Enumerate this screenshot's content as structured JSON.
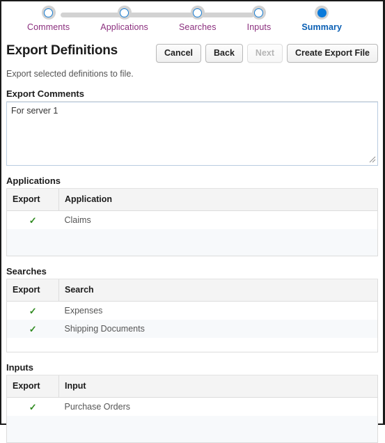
{
  "wizard": {
    "steps": [
      {
        "label": "Comments",
        "active": false
      },
      {
        "label": "Applications",
        "active": false
      },
      {
        "label": "Searches",
        "active": false
      },
      {
        "label": "Inputs",
        "active": false
      },
      {
        "label": "Summary",
        "active": true
      }
    ],
    "active_color": "#0a7ada",
    "inactive_label_color": "#8b2f7e",
    "track_color": "#d2d2d2"
  },
  "header": {
    "title": "Export Definitions",
    "subtitle": "Export selected definitions to file.",
    "buttons": [
      {
        "label": "Cancel",
        "disabled": false
      },
      {
        "label": "Back",
        "disabled": false
      },
      {
        "label": "Next",
        "disabled": true
      },
      {
        "label": "Create Export File",
        "disabled": false
      }
    ]
  },
  "comments": {
    "heading": "Export Comments",
    "value": "For server 1",
    "placeholder": ""
  },
  "applications": {
    "heading": "Applications",
    "columns": [
      "Export",
      "Application"
    ],
    "rows": [
      {
        "export": "✓",
        "name": "Claims"
      }
    ]
  },
  "searches": {
    "heading": "Searches",
    "columns": [
      "Export",
      "Search"
    ],
    "rows": [
      {
        "export": "✓",
        "name": "Expenses"
      },
      {
        "export": "✓",
        "name": "Shipping Documents"
      }
    ]
  },
  "inputs": {
    "heading": "Inputs",
    "columns": [
      "Export",
      "Input"
    ],
    "rows": [
      {
        "export": "✓",
        "name": "Purchase Orders"
      }
    ]
  },
  "icons": {
    "check": "check-icon",
    "resize": "resize-grip-icon"
  },
  "colors": {
    "check_green": "#2f8a1f",
    "accent_blue": "#0a7ada",
    "link_purple": "#8b2f7e"
  }
}
